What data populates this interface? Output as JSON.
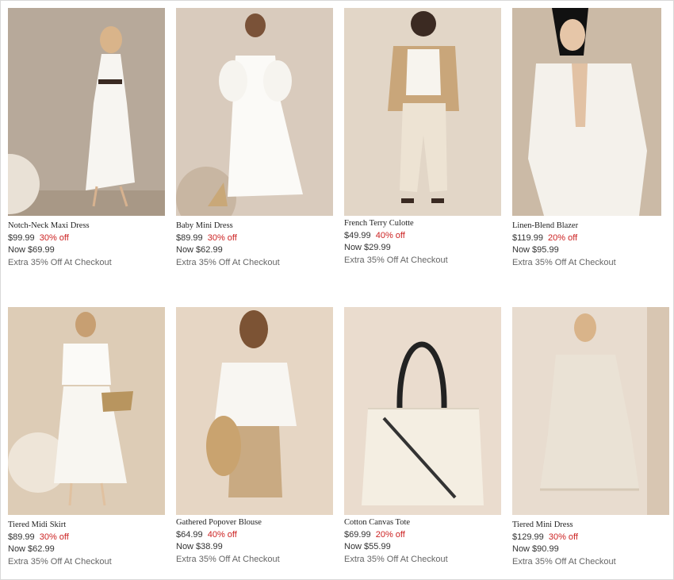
{
  "products": [
    {
      "name": "Notch-Neck Maxi Dress",
      "original_price": "$99.99",
      "discount": "30% off",
      "now_price": "Now $69.99",
      "promo": "Extra 35% Off At Checkout"
    },
    {
      "name": "Baby Mini Dress",
      "original_price": "$89.99",
      "discount": "30% off",
      "now_price": "Now $62.99",
      "promo": "Extra 35% Off At Checkout"
    },
    {
      "name": "French Terry Culotte",
      "original_price": "$49.99",
      "discount": "40% off",
      "now_price": "Now $29.99",
      "promo": "Extra 35% Off At Checkout"
    },
    {
      "name": "Linen-Blend Blazer",
      "original_price": "$119.99",
      "discount": "20% off",
      "now_price": "Now $95.99",
      "promo": "Extra 35% Off At Checkout"
    },
    {
      "name": "Tiered Midi Skirt",
      "original_price": "$89.99",
      "discount": "30% off",
      "now_price": "Now $62.99",
      "promo": "Extra 35% Off At Checkout"
    },
    {
      "name": "Gathered Popover Blouse",
      "original_price": "$64.99",
      "discount": "40% off",
      "now_price": "Now $38.99",
      "promo": "Extra 35% Off At Checkout"
    },
    {
      "name": "Cotton Canvas Tote",
      "original_price": "$69.99",
      "discount": "20% off",
      "now_price": "Now $55.99",
      "promo": "Extra 35% Off At Checkout"
    },
    {
      "name": "Tiered Mini Dress",
      "original_price": "$129.99",
      "discount": "30% off",
      "now_price": "Now $90.99",
      "promo": "Extra 35% Off At Checkout"
    }
  ],
  "colors": {
    "discount": "#cc2222",
    "text": "#333333",
    "promo": "#666666"
  }
}
